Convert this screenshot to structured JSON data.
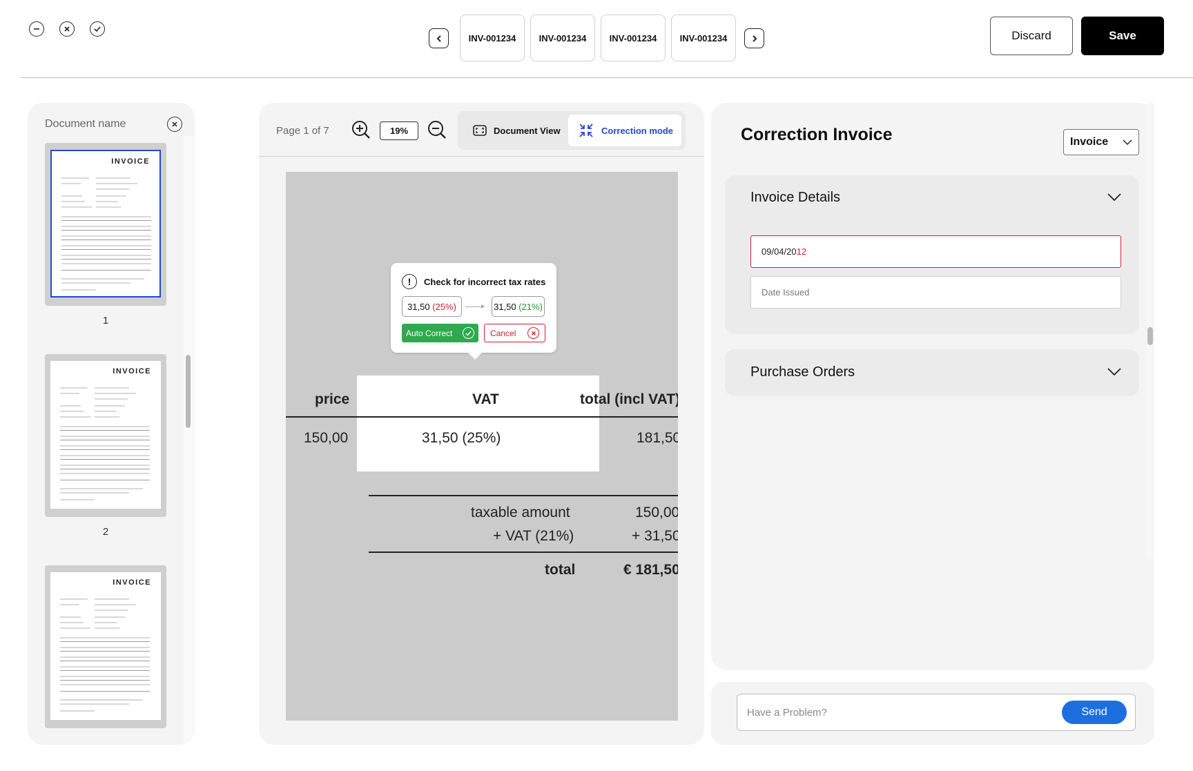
{
  "toolbar": {
    "tabs": [
      "INV-001234",
      "INV-001234",
      "INV-001234",
      "INV-001234"
    ],
    "discard_label": "Discard",
    "save_label": "Save"
  },
  "sidebar": {
    "document_name": "Document name",
    "thumbnails": [
      {
        "page": "1",
        "title": "INVOICE",
        "selected": true
      },
      {
        "page": "2",
        "title": "INVOICE",
        "selected": false
      },
      {
        "page": "",
        "title": "INVOICE",
        "selected": false
      }
    ]
  },
  "viewer": {
    "page_info": "Page 1 of 7",
    "zoom": "19%",
    "document_view_label": "Document View",
    "correction_mode_label": "Correction mode",
    "document": {
      "col_price": "price",
      "col_vat": "VAT",
      "col_total": "total (incl VAT)",
      "row_price": "150,00",
      "row_vat": "31,50 (25%)",
      "row_total": "181,50",
      "taxable_label": "taxable amount",
      "taxable_value": "150,00",
      "vat_label": "+ VAT (21%)",
      "vat_value": "+ 31,50",
      "total_label": "total",
      "total_value": "€ 181,50"
    },
    "popup": {
      "title": "Check for incorrect tax rates",
      "from_amount": "31,50",
      "from_rate": "(25%)",
      "to_amount": "31,50",
      "to_rate": "(21%)",
      "auto_correct_label": "Auto Correct",
      "cancel_label": "Cancel"
    }
  },
  "panel": {
    "title": "Correction Invoice",
    "type_select": "Invoice",
    "invoice_details": {
      "title": "Invoice Details",
      "date_value_prefix": "09/04/20",
      "date_value_error": "12",
      "date_issued_placeholder": "Date Issued"
    },
    "purchase_orders": {
      "title": "Purchase Orders"
    }
  },
  "chat": {
    "placeholder": "Have a Problem?",
    "send_label": "Send"
  },
  "colors": {
    "accent": "#2447c9",
    "error": "#c8202c",
    "success": "#2fa84f",
    "send": "#1d6fe0"
  }
}
